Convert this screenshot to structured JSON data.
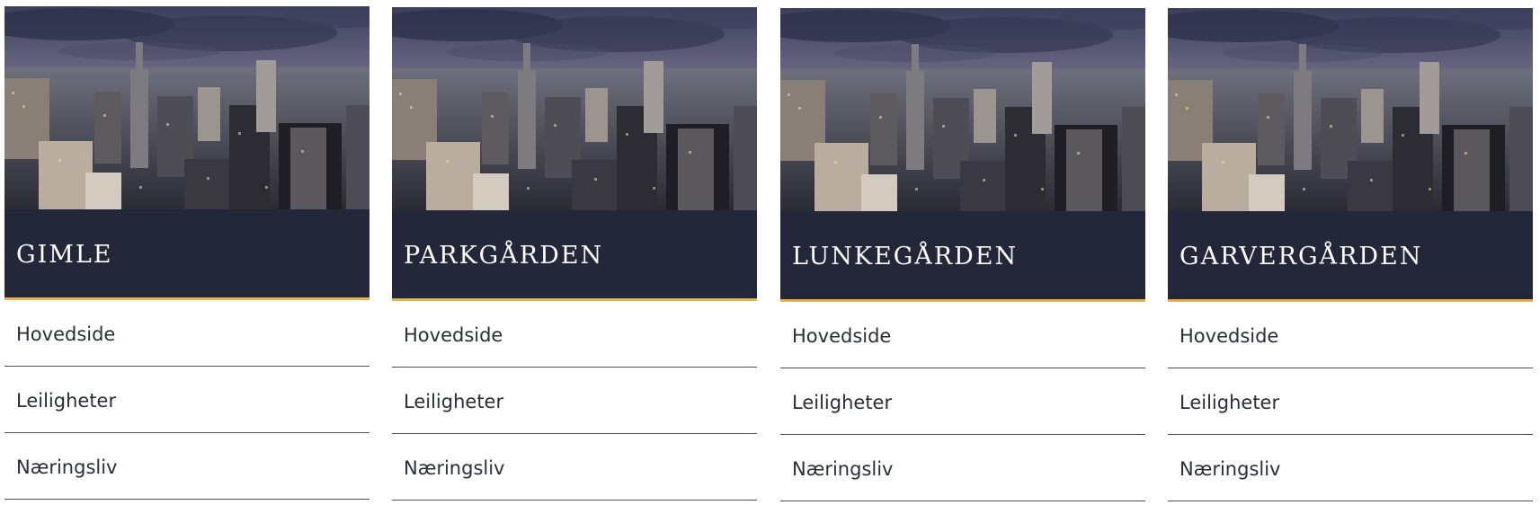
{
  "colors": {
    "title_bar": "#23273a",
    "accent": "#e8b44a",
    "divider": "#4a4d5e",
    "text": "#2b2d3a"
  },
  "cards": [
    {
      "title": "GIMLE",
      "image": "city-skyline-photo",
      "links": [
        "Hovedside",
        "Leiligheter",
        "Næringsliv"
      ]
    },
    {
      "title": "PARKGÅRDEN",
      "image": "city-skyline-photo",
      "links": [
        "Hovedside",
        "Leiligheter",
        "Næringsliv"
      ]
    },
    {
      "title": "LUNKEGÅRDEN",
      "image": "city-skyline-photo",
      "links": [
        "Hovedside",
        "Leiligheter",
        "Næringsliv"
      ]
    },
    {
      "title": "GARVERGÅRDEN",
      "image": "city-skyline-photo",
      "links": [
        "Hovedside",
        "Leiligheter",
        "Næringsliv"
      ]
    }
  ]
}
